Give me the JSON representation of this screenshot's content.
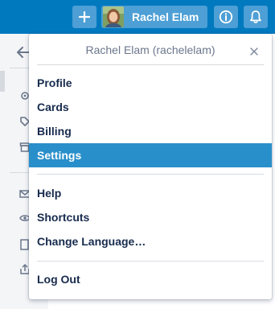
{
  "header": {
    "user_name": "Rachel Elam",
    "bar_color": "#0079bf",
    "icons": [
      "plus-icon",
      "info-icon",
      "bell-icon"
    ]
  },
  "sidebar": {
    "icons": [
      "arrow-left-icon",
      "gear-icon",
      "tag-icon",
      "archive-icon",
      "mail-icon",
      "eye-icon",
      "copy-icon",
      "share-icon"
    ]
  },
  "menu": {
    "title": "Rachel Elam (rachelelam)",
    "close_icon": "close-icon",
    "groups": [
      [
        "Profile",
        "Cards",
        "Billing",
        "Settings"
      ],
      [
        "Help",
        "Shortcuts",
        "Change Language…"
      ],
      [
        "Log Out"
      ]
    ],
    "active_item": "Settings",
    "active_color": "#298fca"
  }
}
